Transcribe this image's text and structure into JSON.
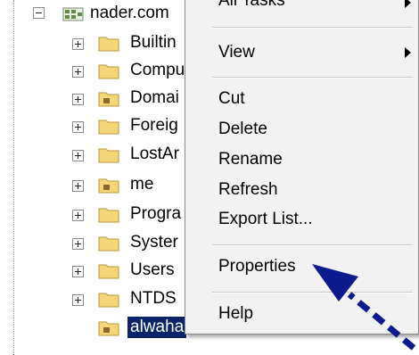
{
  "tree": {
    "root_label": "nader.com",
    "items": [
      {
        "label": "Builtin",
        "icon": "folder-icon"
      },
      {
        "label": "Compu",
        "icon": "folder-icon"
      },
      {
        "label": "Domai",
        "icon": "ou-folder-icon"
      },
      {
        "label": "Foreig",
        "icon": "folder-icon"
      },
      {
        "label": "LostAr",
        "icon": "folder-icon"
      },
      {
        "label": "me",
        "icon": "ou-folder-icon"
      },
      {
        "label": "Progra",
        "icon": "folder-icon"
      },
      {
        "label": "Syster",
        "icon": "folder-icon"
      },
      {
        "label": "Users",
        "icon": "folder-icon"
      },
      {
        "label": "NTDS",
        "icon": "folder-icon"
      },
      {
        "label": "alwaha",
        "icon": "ou-folder-icon",
        "selected": true
      }
    ]
  },
  "context_menu": {
    "all_tasks": "All Tasks",
    "view": "View",
    "cut": "Cut",
    "delete": "Delete",
    "rename": "Rename",
    "refresh": "Refresh",
    "export_list": "Export List...",
    "properties": "Properties",
    "help": "Help"
  },
  "colors": {
    "selection": "#0a246a",
    "annotation_arrow": "#0b1a8c",
    "folder": "#f5d77a"
  }
}
